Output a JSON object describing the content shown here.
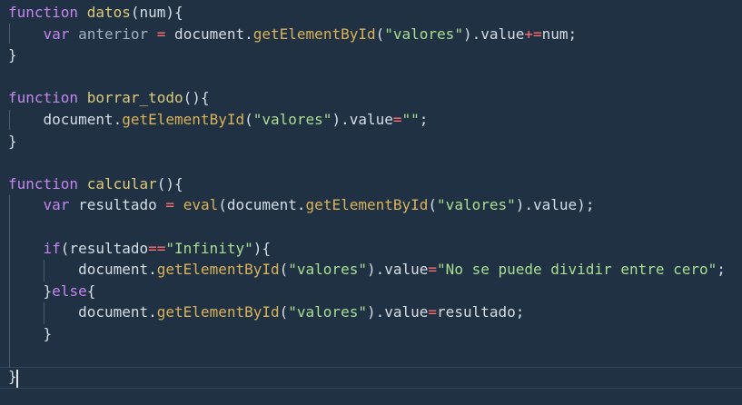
{
  "editor": {
    "lines": [
      [
        {
          "t": "function",
          "c": "keyword"
        },
        {
          "t": " ",
          "c": "plain"
        },
        {
          "t": "datos",
          "c": "fn"
        },
        {
          "t": "(num){",
          "c": "plain"
        }
      ],
      [
        {
          "t": "    ",
          "c": "plain"
        },
        {
          "t": "var",
          "c": "keyword"
        },
        {
          "t": " ",
          "c": "plain"
        },
        {
          "t": "anterior",
          "c": "var"
        },
        {
          "t": " ",
          "c": "plain"
        },
        {
          "t": "=",
          "c": "op"
        },
        {
          "t": " document.",
          "c": "plain"
        },
        {
          "t": "getElementById",
          "c": "method"
        },
        {
          "t": "(",
          "c": "plain"
        },
        {
          "t": "\"valores\"",
          "c": "string"
        },
        {
          "t": ").value",
          "c": "plain"
        },
        {
          "t": "+=",
          "c": "op"
        },
        {
          "t": "num;",
          "c": "plain"
        }
      ],
      [
        {
          "t": "}",
          "c": "plain"
        }
      ],
      [],
      [
        {
          "t": "function",
          "c": "keyword"
        },
        {
          "t": " ",
          "c": "plain"
        },
        {
          "t": "borrar_todo",
          "c": "fn"
        },
        {
          "t": "(){",
          "c": "plain"
        }
      ],
      [
        {
          "t": "    document.",
          "c": "plain"
        },
        {
          "t": "getElementById",
          "c": "method"
        },
        {
          "t": "(",
          "c": "plain"
        },
        {
          "t": "\"valores\"",
          "c": "string"
        },
        {
          "t": ").value",
          "c": "plain"
        },
        {
          "t": "=",
          "c": "op"
        },
        {
          "t": "\"\"",
          "c": "string"
        },
        {
          "t": ";",
          "c": "plain"
        }
      ],
      [
        {
          "t": "}",
          "c": "plain"
        }
      ],
      [],
      [
        {
          "t": "function",
          "c": "keyword"
        },
        {
          "t": " ",
          "c": "plain"
        },
        {
          "t": "calcular",
          "c": "fn"
        },
        {
          "t": "(){",
          "c": "plain"
        }
      ],
      [
        {
          "t": "    ",
          "c": "plain"
        },
        {
          "t": "var",
          "c": "keyword"
        },
        {
          "t": " resultado ",
          "c": "plain"
        },
        {
          "t": "=",
          "c": "op"
        },
        {
          "t": " ",
          "c": "plain"
        },
        {
          "t": "eval",
          "c": "method"
        },
        {
          "t": "(document.",
          "c": "plain"
        },
        {
          "t": "getElementById",
          "c": "method"
        },
        {
          "t": "(",
          "c": "plain"
        },
        {
          "t": "\"valores\"",
          "c": "string"
        },
        {
          "t": ").value);",
          "c": "plain"
        }
      ],
      [],
      [
        {
          "t": "    ",
          "c": "plain"
        },
        {
          "t": "if",
          "c": "keyword"
        },
        {
          "t": "(resultado",
          "c": "plain"
        },
        {
          "t": "==",
          "c": "op"
        },
        {
          "t": "\"Infinity\"",
          "c": "string"
        },
        {
          "t": "){",
          "c": "plain"
        }
      ],
      [
        {
          "t": "        document.",
          "c": "plain"
        },
        {
          "t": "getElementById",
          "c": "method"
        },
        {
          "t": "(",
          "c": "plain"
        },
        {
          "t": "\"valores\"",
          "c": "string"
        },
        {
          "t": ").value",
          "c": "plain"
        },
        {
          "t": "=",
          "c": "op"
        },
        {
          "t": "\"No se puede dividir entre cero\"",
          "c": "string"
        },
        {
          "t": ";",
          "c": "plain"
        }
      ],
      [
        {
          "t": "    }",
          "c": "plain"
        },
        {
          "t": "else",
          "c": "keyword"
        },
        {
          "t": "{",
          "c": "plain"
        }
      ],
      [
        {
          "t": "        document.",
          "c": "plain"
        },
        {
          "t": "getElementById",
          "c": "method"
        },
        {
          "t": "(",
          "c": "plain"
        },
        {
          "t": "\"valores\"",
          "c": "string"
        },
        {
          "t": ").value",
          "c": "plain"
        },
        {
          "t": "=",
          "c": "op"
        },
        {
          "t": "resultado;",
          "c": "plain"
        }
      ],
      [
        {
          "t": "    }",
          "c": "plain"
        }
      ],
      [],
      [
        {
          "t": "}",
          "c": "plain"
        }
      ]
    ]
  },
  "theme": {
    "background": "#1f3142",
    "keyword": "#c586ee",
    "function_name": "#dcc97a",
    "method": "#d9b25a",
    "string": "#a9de92",
    "operator": "#ff6e6e",
    "variable": "#9fb1c4",
    "text": "#d6dde6"
  }
}
